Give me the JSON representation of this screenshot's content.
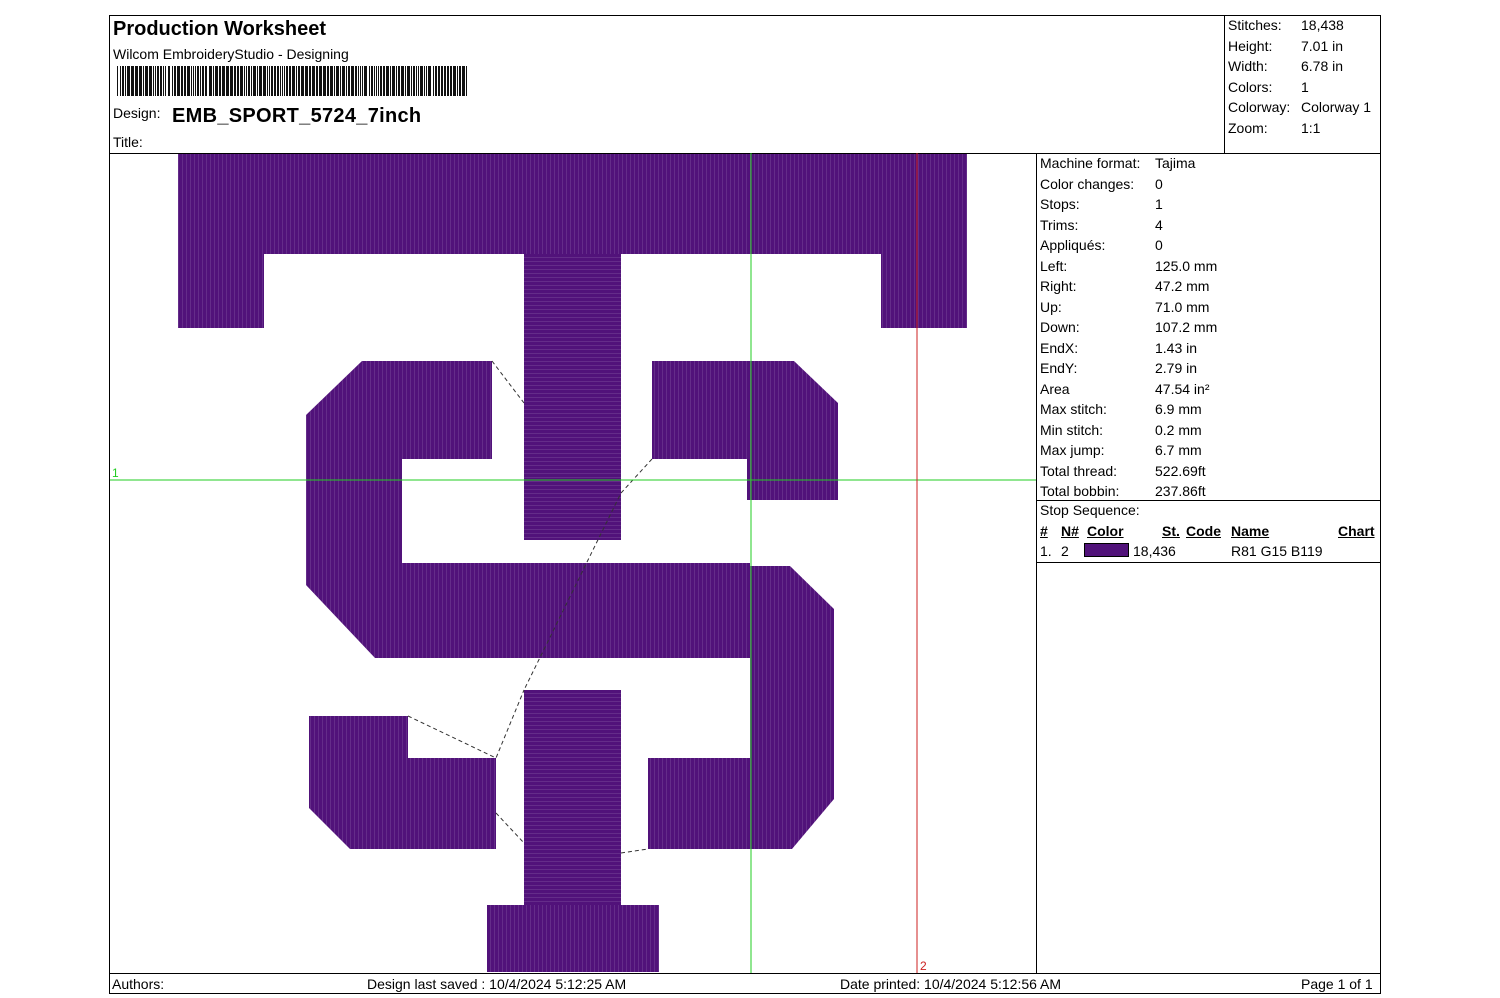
{
  "header": {
    "title": "Production Worksheet",
    "subtitle": "Wilcom EmbroideryStudio - Designing",
    "design_label": "Design:",
    "design_name": "EMB_SPORT_5724_7inch",
    "title_label": "Title:"
  },
  "summary": [
    {
      "label": "Stitches:",
      "value": "18,438"
    },
    {
      "label": "Height:",
      "value": "7.01 in"
    },
    {
      "label": "Width:",
      "value": "6.78 in"
    },
    {
      "label": "Colors:",
      "value": "1"
    },
    {
      "label": "Colorway:",
      "value": "Colorway 1"
    },
    {
      "label": "Zoom:",
      "value": "1:1"
    }
  ],
  "details": [
    {
      "label": "Machine format:",
      "value": "Tajima"
    },
    {
      "label": "Color changes:",
      "value": "0"
    },
    {
      "label": "Stops:",
      "value": "1"
    },
    {
      "label": "Trims:",
      "value": "4"
    },
    {
      "label": "Appliqués:",
      "value": "0"
    },
    {
      "label": "Left:",
      "value": "125.0 mm"
    },
    {
      "label": "Right:",
      "value": "47.2 mm"
    },
    {
      "label": "Up:",
      "value": "71.0 mm"
    },
    {
      "label": "Down:",
      "value": "107.2 mm"
    },
    {
      "label": "EndX:",
      "value": "1.43 in"
    },
    {
      "label": "EndY:",
      "value": "2.79 in"
    },
    {
      "label": "Area",
      "value": " 47.54 in²"
    },
    {
      "label": "Max stitch:",
      "value": "6.9 mm"
    },
    {
      "label": "Min stitch:",
      "value": "0.2 mm"
    },
    {
      "label": "Max jump:",
      "value": "6.7 mm"
    },
    {
      "label": "Total thread:",
      "value": "522.69ft"
    },
    {
      "label": "Total bobbin:",
      "value": "237.86ft"
    }
  ],
  "stop_sequence": {
    "title": "Stop Sequence:",
    "headers": {
      "num": "#",
      "needle": "N#",
      "color": "Color",
      "stitches": "St.",
      "code": "Code",
      "name": "Name",
      "chart": "Chart"
    },
    "rows": [
      {
        "num": "1.",
        "needle": "2",
        "color_hex": "#51127a",
        "stitches": "18,436",
        "code": "",
        "name": "R81 G15 B119",
        "chart": ""
      }
    ]
  },
  "canvas": {
    "thread_color": "#51127a",
    "guide_green": "#22cc22",
    "guide_red": "#cc2222",
    "guide_1_label": "1",
    "guide_2_label": "2"
  },
  "footer": {
    "authors_label": "Authors:",
    "last_saved": "Design last saved : 10/4/2024 5:12:25 AM",
    "date_printed": "Date printed: 10/4/2024 5:12:56 AM",
    "page": "Page 1 of 1"
  }
}
